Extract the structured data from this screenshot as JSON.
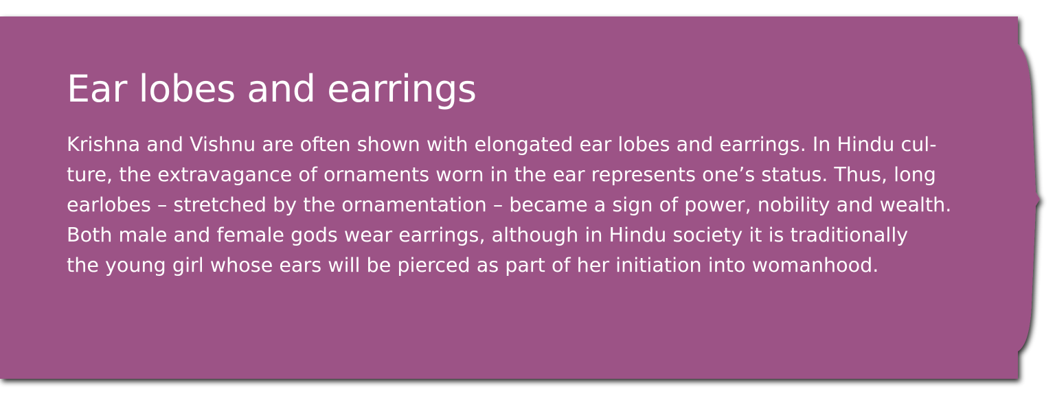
{
  "colors": {
    "panel_fill": "#9c5286",
    "panel_shadow": "#3a2f36",
    "text": "#ffffff"
  },
  "title": "Ear lobes and earrings",
  "body_lines": [
    "Krishna and Vishnu are often shown with elongated ear lobes and earrings. In Hindu cul-",
    "ture, the extravagance of ornaments worn in the ear represents one’s status. Thus, long",
    "earlobes – stretched by the ornamentation – became a sign of power, nobility and wealth.",
    "Both male and female gods wear earrings, although in Hindu society it is traditionally",
    "the young girl whose ears will be pierced as part of her initiation into womanhood."
  ]
}
